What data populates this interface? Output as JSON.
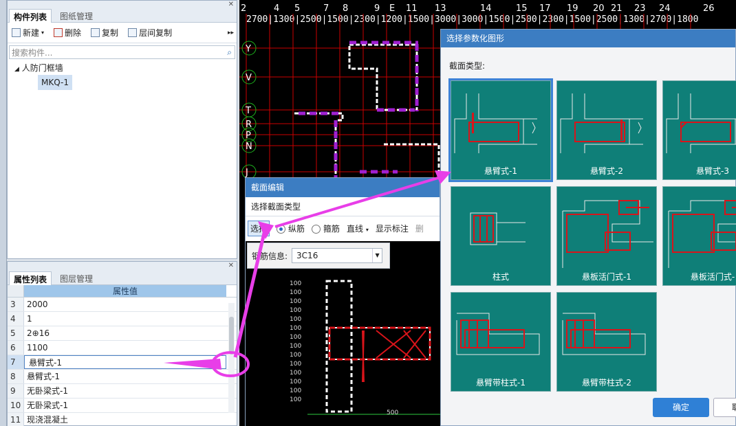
{
  "component_panel": {
    "tabs": [
      "构件列表",
      "图纸管理"
    ],
    "toolbar": {
      "new": "新建",
      "delete": "删除",
      "copy": "复制",
      "floor_copy": "层间复制"
    },
    "search_placeholder": "搜索构件...",
    "tree": {
      "parent": "人防门框墙",
      "child": "MKQ-1"
    }
  },
  "property_panel": {
    "tabs": [
      "属性列表",
      "图层管理"
    ],
    "column_header": "属性值",
    "rows": [
      {
        "num": "3",
        "value": "2000"
      },
      {
        "num": "4",
        "value": "1"
      },
      {
        "num": "5",
        "value": "2⊕16"
      },
      {
        "num": "6",
        "value": "1100"
      },
      {
        "num": "7",
        "value": "悬臂式-1"
      },
      {
        "num": "8",
        "value": "悬臂式-1"
      },
      {
        "num": "9",
        "value": "无卧梁式-1"
      },
      {
        "num": "10",
        "value": "无卧梁式-1"
      },
      {
        "num": "11",
        "value": "现浇混凝土"
      }
    ]
  },
  "cad": {
    "top_numbers": [
      "2",
      "4",
      "5",
      "7",
      "8",
      "9",
      "E",
      "11",
      "13",
      "14",
      "15",
      "17",
      "19",
      "20",
      "21",
      "23",
      "24",
      "26"
    ],
    "top_dims": "2700|1300|2500|1500|2300|1200|1500|3000|3000|1500|2500|2300|1500|2500|1300|2700|1800",
    "axis_letters": [
      "Y",
      "V",
      "T",
      "R",
      "P",
      "N",
      "J"
    ]
  },
  "section_dialog": {
    "title": "截面编辑",
    "select_type": "选择截面类型",
    "toolbar": {
      "select": "选择",
      "longitudinal": "纵筋",
      "stirrup": "箍筋",
      "line": "直线",
      "show_annot": "显示标注",
      "delete": "删"
    },
    "rebar_label": "钢筋信息:",
    "rebar_value": "3C16",
    "dim_tick": "100",
    "bottom_label": "500"
  },
  "param_dialog": {
    "title": "选择参数化图形",
    "section_type_label": "截面类型:",
    "tiles": [
      "悬臂式-1",
      "悬臂式-2",
      "悬臂式-3",
      "柱式",
      "悬板活门式-1",
      "悬板活门式-",
      "悬臂带柱式-1",
      "悬臂带柱式-2"
    ],
    "ok": "确定",
    "cancel": "取"
  },
  "colors": {
    "tile_bg": "#0f7f78",
    "accent": "#3c7dc2",
    "arrow": "#e83ee8",
    "rebar": "#d9141a"
  }
}
